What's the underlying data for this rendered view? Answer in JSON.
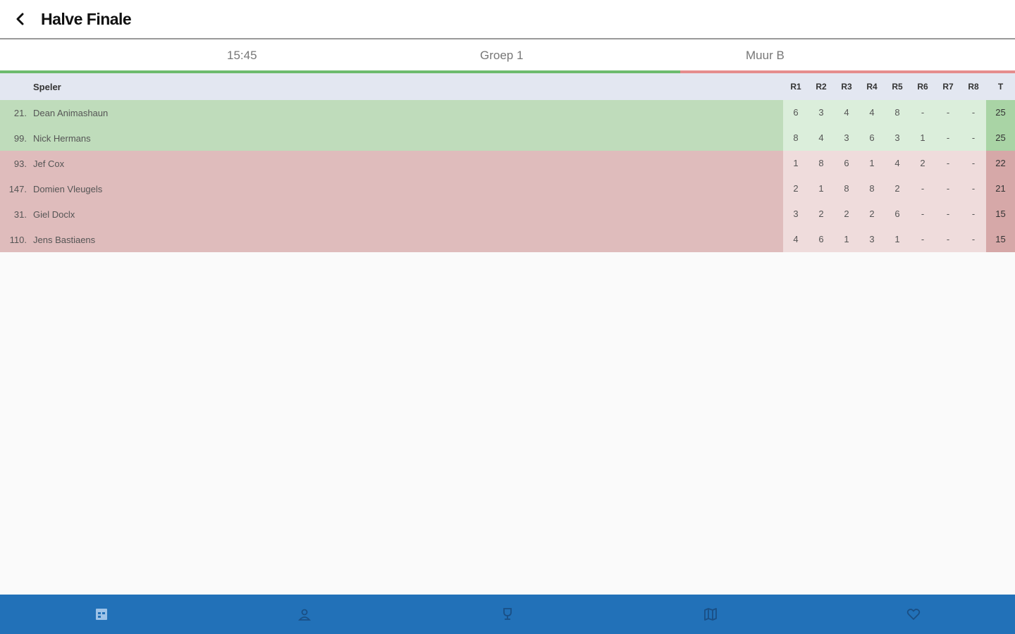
{
  "header": {
    "title": "Halve Finale",
    "back_icon": "arrow-back-icon"
  },
  "info": {
    "time": "15:45",
    "group": "Groep 1",
    "wall": "Muur B"
  },
  "progress": {
    "green_fraction": 0.67
  },
  "table": {
    "headers": {
      "player": "Speler",
      "rounds": [
        "R1",
        "R2",
        "R3",
        "R4",
        "R5",
        "R6",
        "R7",
        "R8"
      ],
      "total": "T"
    },
    "rows": [
      {
        "num": "21.",
        "name": "Dean Animashaun",
        "status": "green",
        "scores": [
          "6",
          "3",
          "4",
          "4",
          "8",
          "-",
          "-",
          "-"
        ],
        "total": "25"
      },
      {
        "num": "99.",
        "name": "Nick Hermans",
        "status": "green",
        "scores": [
          "8",
          "4",
          "3",
          "6",
          "3",
          "1",
          "-",
          "-"
        ],
        "total": "25"
      },
      {
        "num": "93.",
        "name": "Jef Cox",
        "status": "red",
        "scores": [
          "1",
          "8",
          "6",
          "1",
          "4",
          "2",
          "-",
          "-"
        ],
        "total": "22"
      },
      {
        "num": "147.",
        "name": "Domien Vleugels",
        "status": "red",
        "scores": [
          "2",
          "1",
          "8",
          "8",
          "2",
          "-",
          "-",
          "-"
        ],
        "total": "21"
      },
      {
        "num": "31.",
        "name": "Giel Doclx",
        "status": "red",
        "scores": [
          "3",
          "2",
          "2",
          "2",
          "6",
          "-",
          "-",
          "-"
        ],
        "total": "15"
      },
      {
        "num": "110.",
        "name": "Jens Bastiaens",
        "status": "red",
        "scores": [
          "4",
          "6",
          "1",
          "3",
          "1",
          "-",
          "-",
          "-"
        ],
        "total": "15"
      }
    ]
  },
  "nav": {
    "accent": "#2271b8",
    "items": [
      {
        "icon": "calendar-icon"
      },
      {
        "icon": "person-icon"
      },
      {
        "icon": "trophy-icon"
      },
      {
        "icon": "map-icon"
      },
      {
        "icon": "heart-icon"
      }
    ]
  }
}
